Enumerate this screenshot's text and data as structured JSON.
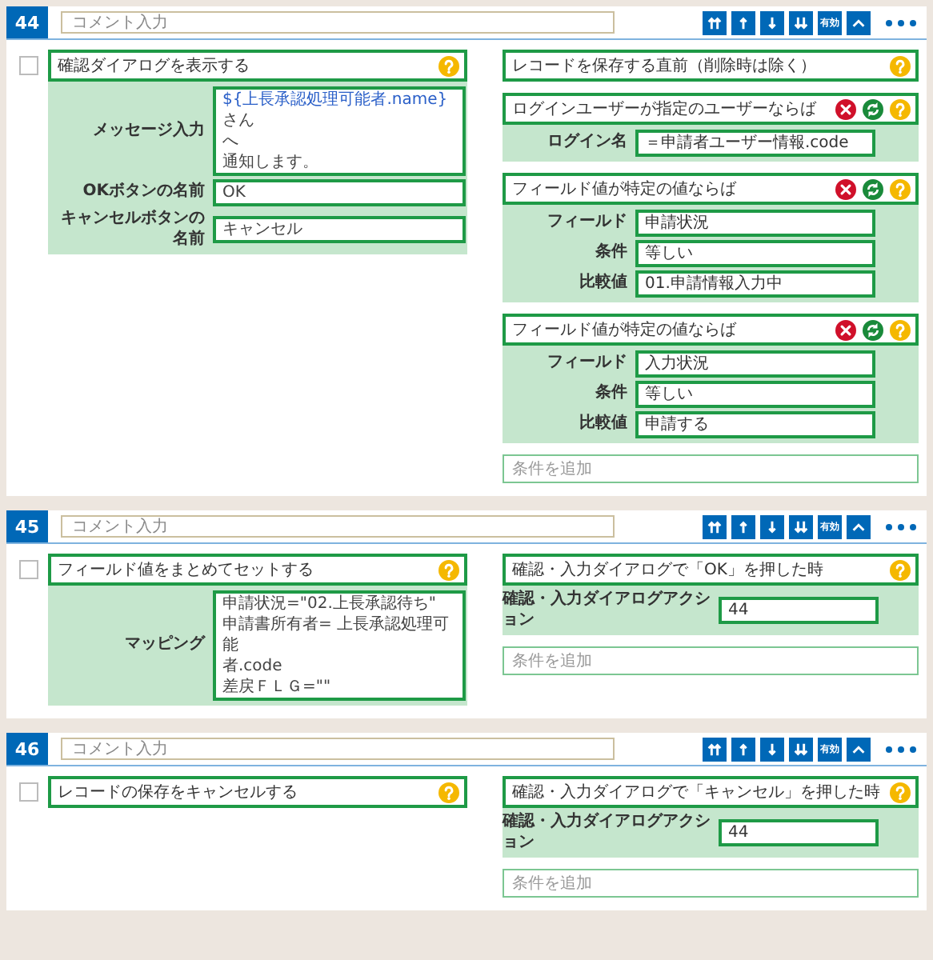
{
  "rules": [
    {
      "number": "44",
      "comment": {
        "placeholder": "コメント入力"
      },
      "toggle_label": "有効",
      "checked": false,
      "action": {
        "title": "確認ダイアログを表示する",
        "fields": [
          {
            "label": "メッセージ入力",
            "lines": [
              [
                {
                  "kind": "variable",
                  "text": "${上長承認処理可能者.name}"
                },
                {
                  "kind": "plain",
                  "text": "さん"
                }
              ],
              [
                {
                  "kind": "plain",
                  "text": "へ"
                }
              ],
              [
                {
                  "kind": "plain",
                  "text": "通知します。"
                }
              ]
            ]
          },
          {
            "label": "OKボタンの名前",
            "lines": [
              [
                {
                  "kind": "plain",
                  "text": "OK"
                }
              ]
            ]
          },
          {
            "label": "キャンセルボタンの名前",
            "lines": [
              [
                {
                  "kind": "plain",
                  "text": "キャンセル"
                }
              ]
            ]
          }
        ]
      },
      "triggers": [
        {
          "kind": "event",
          "title": "レコードを保存する直前（削除時は除く）"
        },
        {
          "kind": "condition",
          "title": "ログインユーザーが指定のユーザーならば",
          "fields": [
            {
              "label": "ログイン名",
              "value": "＝申請者ユーザー情報.code"
            }
          ]
        },
        {
          "kind": "condition",
          "title": "フィールド値が特定の値ならば",
          "fields": [
            {
              "label": "フィールド",
              "value": "申請状況"
            },
            {
              "label": "条件",
              "value": "等しい"
            },
            {
              "label": "比較値",
              "value": "01.申請情報入力中"
            }
          ]
        },
        {
          "kind": "condition",
          "title": "フィールド値が特定の値ならば",
          "fields": [
            {
              "label": "フィールド",
              "value": "入力状況"
            },
            {
              "label": "条件",
              "value": "等しい"
            },
            {
              "label": "比較値",
              "value": "申請する"
            }
          ]
        }
      ],
      "add_condition": {
        "placeholder": "条件を追加"
      }
    },
    {
      "number": "45",
      "comment": {
        "placeholder": "コメント入力"
      },
      "toggle_label": "有効",
      "checked": false,
      "action": {
        "title": "フィールド値をまとめてセットする",
        "fields": [
          {
            "label": "マッピング",
            "lines": [
              [
                {
                  "kind": "plain",
                  "text": "申請状況=\"02.上長承認待ち\""
                }
              ],
              [
                {
                  "kind": "plain",
                  "text": "申請書所有者= 上長承認処理可能"
                }
              ],
              [
                {
                  "kind": "plain",
                  "text": "者.code"
                }
              ],
              [
                {
                  "kind": "plain",
                  "text": "差戻ＦＬＧ=\"\""
                }
              ]
            ]
          }
        ]
      },
      "triggers": [
        {
          "kind": "event",
          "title": "確認・入力ダイアログで「OK」を押した時",
          "fields": [
            {
              "label": "確認・入力ダイアログアクション",
              "value": "44"
            }
          ]
        }
      ],
      "add_condition": {
        "placeholder": "条件を追加"
      }
    },
    {
      "number": "46",
      "comment": {
        "placeholder": "コメント入力"
      },
      "toggle_label": "有効",
      "checked": false,
      "action": {
        "title": "レコードの保存をキャンセルする"
      },
      "triggers": [
        {
          "kind": "event",
          "title": "確認・入力ダイアログで「キャンセル」を押した時",
          "fields": [
            {
              "label": "確認・入力ダイアログアクション",
              "value": "44"
            }
          ]
        }
      ],
      "add_condition": {
        "placeholder": "条件を追加"
      }
    }
  ]
}
